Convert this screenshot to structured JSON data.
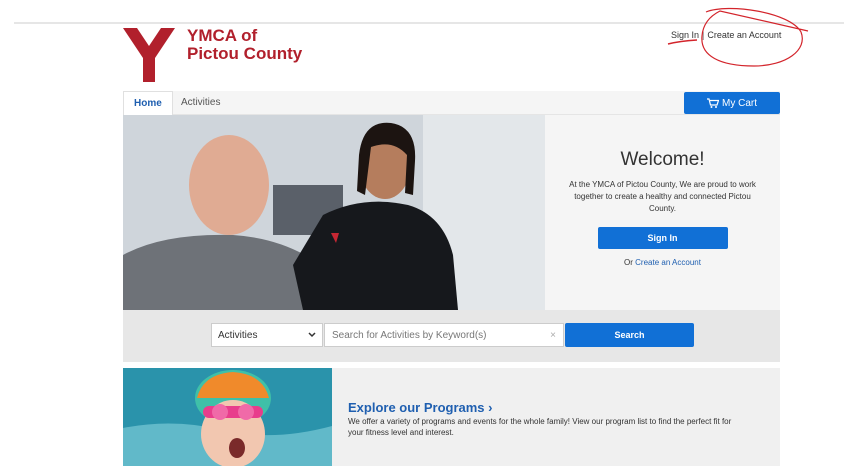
{
  "brand": {
    "line1": "YMCA of",
    "line2": "Pictou County"
  },
  "auth": {
    "sign_in": "Sign In",
    "separator": "|",
    "create_account": "Create an Account"
  },
  "nav": {
    "tabs": [
      {
        "label": "Home",
        "active": true
      },
      {
        "label": "Activities",
        "active": false
      }
    ],
    "cart_label": "My Cart"
  },
  "hero": {
    "title": "Welcome!",
    "text": "At the YMCA of Pictou County, We are proud to work together to create a healthy and connected Pictou County.",
    "sign_in_button": "Sign In",
    "or_text": "Or",
    "create_account_link": "Create an Account"
  },
  "search": {
    "category": "Activities",
    "placeholder": "Search for Activities by Keyword(s)",
    "clear": "×",
    "button": "Search"
  },
  "programs": {
    "title": "Explore our Programs",
    "chevron": "›",
    "text": "We offer a variety of programs and events for the whole family! View our program list to find the perfect fit for your fitness level and interest."
  },
  "colors": {
    "brand_red": "#b1202c",
    "primary_blue": "#1170d6",
    "link_blue": "#1f5fb0",
    "annotation_red": "#d3242b"
  },
  "icons": {
    "cart": "cart-icon",
    "dropdown": "chevron-down-icon",
    "logo": "ymca-logo-icon"
  }
}
